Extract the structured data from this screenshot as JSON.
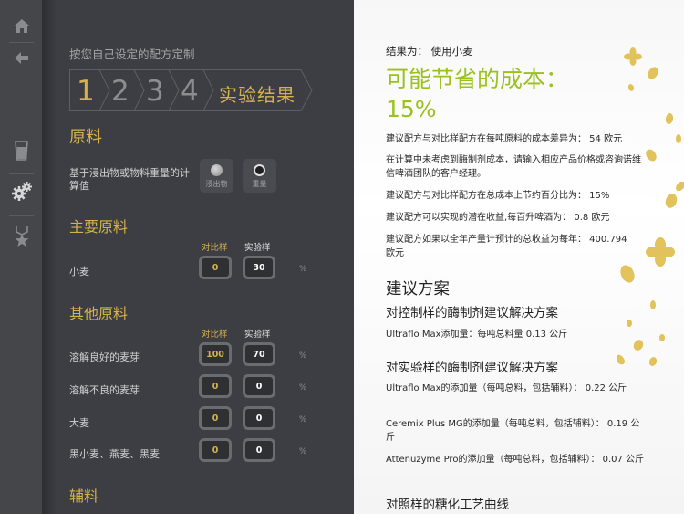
{
  "rail": {
    "icons": [
      "home-icon",
      "back-arrow-icon",
      "glass-icon",
      "gears-icon",
      "star-badge-icon"
    ]
  },
  "left": {
    "breadcrumb": "按您自己设定的配方定制",
    "steps": [
      "1",
      "2",
      "3",
      "4"
    ],
    "final_step": "实验结果",
    "raw_section": "原料",
    "basis_label": "基于浸出物或物料重量的计算值",
    "basis_options": [
      "浸出物",
      "重量"
    ],
    "basis_selected": "重量",
    "main_section": "主要原料",
    "col_control": "对比样",
    "col_experiment": "实验样",
    "main_rows": [
      {
        "label": "小麦",
        "control": "0",
        "experiment": "30",
        "unit": "%"
      }
    ],
    "other_section": "其他原料",
    "other_rows": [
      {
        "label": "溶解良好的麦芽",
        "control": "100",
        "experiment": "70",
        "unit": "%"
      },
      {
        "label": "溶解不良的麦芽",
        "control": "0",
        "experiment": "0",
        "unit": "%"
      },
      {
        "label": "大麦",
        "control": "0",
        "experiment": "0",
        "unit": "%"
      },
      {
        "label": "黑小麦、燕麦、黑麦",
        "control": "0",
        "experiment": "0",
        "unit": "%"
      }
    ],
    "aux_section": "辅料"
  },
  "right": {
    "result_line": "结果为：  使用小麦",
    "savings_title": "可能节省的成本：",
    "savings_value": "15%",
    "p1": "建议配方与对比样配方在每吨原料的成本差异为：  54 欧元",
    "p2": "在计算中未考虑到酶制剂成本，请输入相应产品价格或咨询诺维信啤酒团队的客户经理。",
    "p3": "建议配方与对比样配方在总成本上节约百分比为：  15%",
    "p4": "建议配方可以实现的潜在收益,每百升啤酒为：  0.8 欧元",
    "p5": "建议配方如果以全年产量计预计的总收益为每年：  400.794 欧元",
    "plan_title": "建议方案",
    "control_plan_title": "对控制样的酶制剂建议解决方案",
    "control_plan_1": "Ultraflo Max添加量：每吨总料量 0.13 公斤",
    "exp_plan_title": "对实验样的酶制剂建议解决方案",
    "exp_plan_1": "Ultraflo Max的添加量（每吨总料，包括辅料）：  0.22 公斤",
    "exp_plan_2": "Ceremix Plus MG的添加量（每吨总料，包括辅料）：  0.19 公斤",
    "exp_plan_3": "Attenuzyme Pro的添加量（每吨总料，包括辅料）：  0.07 公斤",
    "curve_title": "对照样的糖化工艺曲线"
  },
  "colors": {
    "accent_gold": "#d4b24c",
    "accent_green": "#9bc21c",
    "petal": "#e2c25a"
  }
}
